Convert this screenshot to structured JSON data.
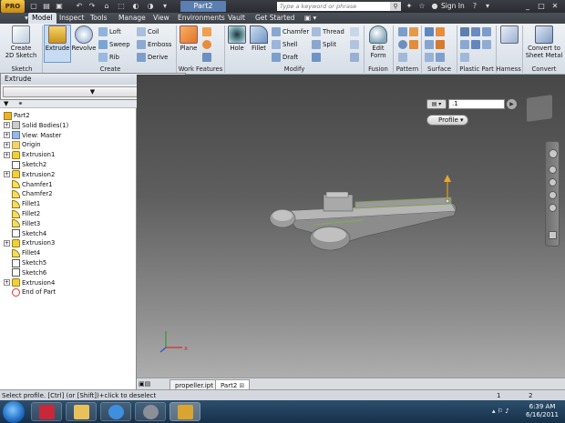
{
  "app": {
    "logo_text": "PRO",
    "document_title": "Part2"
  },
  "titlebar": {
    "search_placeholder": "Type a keyword or phrase",
    "sign_in": "Sign In"
  },
  "ribbon_tabs": [
    "Model",
    "Inspect",
    "Tools",
    "Manage",
    "View",
    "Environments",
    "Vault",
    "Get Started"
  ],
  "ribbon": {
    "sketch": {
      "create_2d_label": "Create\n2D Sketch",
      "panel": "Sketch"
    },
    "create": {
      "extrude": "Extrude",
      "revolve": "Revolve",
      "loft": "Loft",
      "sweep": "Sweep",
      "rib": "Rib",
      "coil": "Coil",
      "emboss": "Emboss",
      "derive": "Derive",
      "panel": "Create"
    },
    "work_features": {
      "plane": "Plane",
      "panel": "Work Features"
    },
    "modify": {
      "hole": "Hole",
      "fillet": "Fillet",
      "chamfer": "Chamfer",
      "shell": "Shell",
      "draft": "Draft",
      "thread": "Thread",
      "split": "Split",
      "panel": "Modify"
    },
    "fusion": {
      "edit_form": "Edit\nForm",
      "panel": "Fusion"
    },
    "pattern": {
      "panel": "Pattern"
    },
    "surface": {
      "panel": "Surface"
    },
    "plastic": {
      "panel": "Plastic Part"
    },
    "harness": {
      "panel": "Harness"
    },
    "convert": {
      "sheet_metal": "Convert to\nSheet Metal",
      "panel": "Convert"
    }
  },
  "dialog": {
    "title": "Extrude",
    "close": "✕"
  },
  "browser": {
    "items": [
      {
        "label": "Part2",
        "icon": "part-icon",
        "indent": 0,
        "expander": ""
      },
      {
        "label": "Solid Bodies(1)",
        "icon": "solid-bodies-icon",
        "indent": 1,
        "expander": "+"
      },
      {
        "label": "View: Master",
        "icon": "view-icon",
        "indent": 1,
        "expander": "+"
      },
      {
        "label": "Origin",
        "icon": "folder-icon",
        "indent": 1,
        "expander": "+"
      },
      {
        "label": "Extrusion1",
        "icon": "extrusion-icon",
        "indent": 1,
        "expander": "+"
      },
      {
        "label": "Sketch2",
        "icon": "sketch-icon",
        "indent": 1,
        "expander": ""
      },
      {
        "label": "Extrusion2",
        "icon": "extrusion-icon",
        "indent": 1,
        "expander": "+"
      },
      {
        "label": "Chamfer1",
        "icon": "chamfer-icon",
        "indent": 1,
        "expander": ""
      },
      {
        "label": "Chamfer2",
        "icon": "chamfer-icon",
        "indent": 1,
        "expander": ""
      },
      {
        "label": "Fillet1",
        "icon": "fillet-icon",
        "indent": 1,
        "expander": ""
      },
      {
        "label": "Fillet2",
        "icon": "fillet-icon",
        "indent": 1,
        "expander": ""
      },
      {
        "label": "Fillet3",
        "icon": "fillet-icon",
        "indent": 1,
        "expander": ""
      },
      {
        "label": "Sketch4",
        "icon": "sketch-icon",
        "indent": 1,
        "expander": ""
      },
      {
        "label": "Extrusion3",
        "icon": "extrusion-icon",
        "indent": 1,
        "expander": "+"
      },
      {
        "label": "Fillet4",
        "icon": "fillet-icon",
        "indent": 1,
        "expander": ""
      },
      {
        "label": "Sketch5",
        "icon": "sketch-icon",
        "indent": 1,
        "expander": ""
      },
      {
        "label": "Sketch6",
        "icon": "sketch-icon",
        "indent": 1,
        "expander": ""
      },
      {
        "label": "Extrusion4",
        "icon": "extrusion-icon",
        "indent": 1,
        "expander": "+"
      },
      {
        "label": "End of Part",
        "icon": "end-of-part-icon",
        "indent": 1,
        "expander": ""
      }
    ]
  },
  "viewport": {
    "distance_value": ".1",
    "profile_label": "Profile"
  },
  "doc_tabs": [
    "propeller.ipt",
    "Part2"
  ],
  "status": {
    "message": "Select profile. [Ctrl] (or [Shift])+click to deselect",
    "count_a": "1",
    "count_b": "2"
  },
  "taskbar": {
    "time": "6:39 AM",
    "date": "6/16/2011"
  }
}
